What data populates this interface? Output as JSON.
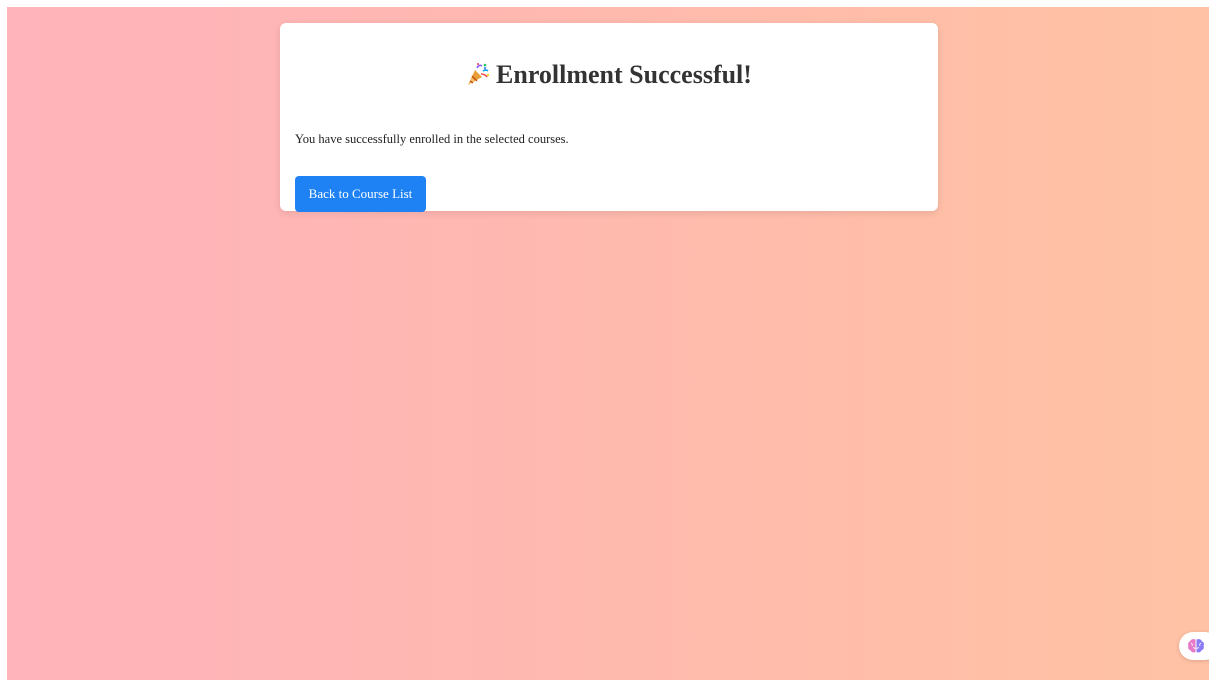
{
  "colors": {
    "background_gradient_start": "#ffb3bb",
    "background_gradient_end": "#ffc2a5",
    "card_background": "#ffffff",
    "button_background": "#1e82f5",
    "title_text": "#333333"
  },
  "card": {
    "title_icon": "party-popper-icon",
    "title": "Enrollment Successful!",
    "message": "You have successfully enrolled in the selected courses.",
    "back_button_label": "Back to Course List"
  },
  "floating_button": {
    "icon": "brain-icon"
  }
}
